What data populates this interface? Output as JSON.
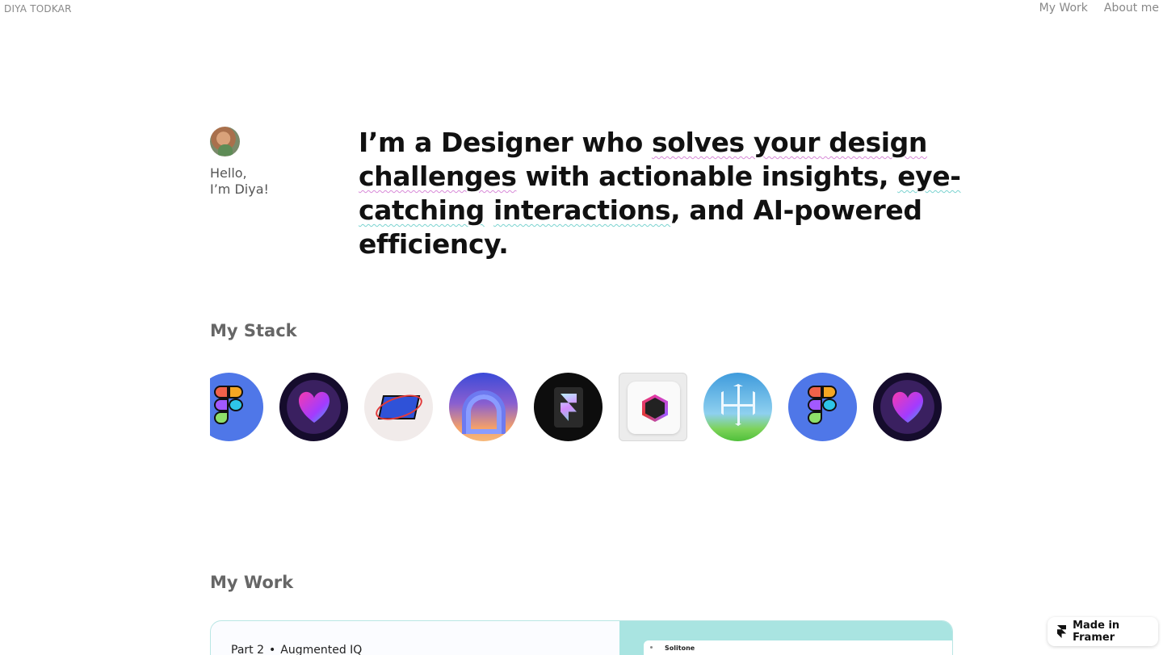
{
  "header": {
    "brand": "DIYA TODKAR",
    "nav": [
      {
        "label": "My Work"
      },
      {
        "label": "About me"
      }
    ]
  },
  "intro": {
    "greeting_line1": "Hello,",
    "greeting_line2": "I’m Diya!",
    "headline": {
      "part1": "I’m a Designer who ",
      "highlight1": "solves your design challenges",
      "part2": " with actionable insights, ",
      "highlight2": "eye-catching",
      "part3": " ",
      "highlight3": "interactions",
      "part4": ", and AI-powered efficiency."
    }
  },
  "stack": {
    "title": "My Stack",
    "tools": [
      {
        "icon": "figma-icon"
      },
      {
        "icon": "heart-app-icon"
      },
      {
        "icon": "webflow-icon"
      },
      {
        "icon": "arch-app-icon"
      },
      {
        "icon": "framer-icon"
      },
      {
        "icon": "cube-app-icon"
      },
      {
        "icon": "perplexity-icon"
      },
      {
        "icon": "figma-icon"
      },
      {
        "icon": "heart-app-icon"
      }
    ]
  },
  "work": {
    "title": "My Work",
    "card": {
      "part": "Part 2",
      "separator": "•",
      "project": "Augmented IQ",
      "preview_brand": "Solitone"
    }
  },
  "badge": {
    "label": "Made in Framer"
  },
  "colors": {
    "squiggle_pink": "#d88ad8",
    "squiggle_teal": "#7bd3d0",
    "card_accent": "#a9e4e1"
  }
}
